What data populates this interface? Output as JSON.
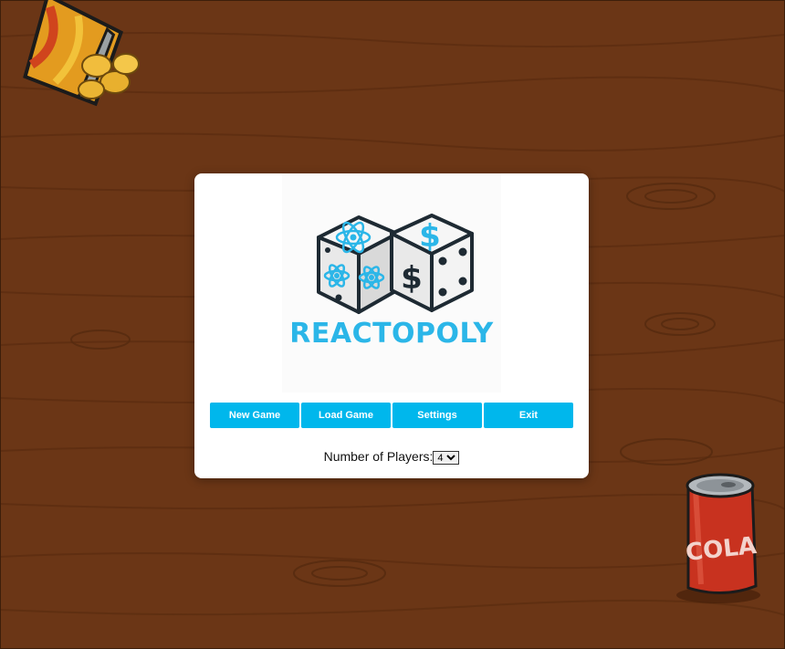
{
  "logo": {
    "title": "REACTOPOLY"
  },
  "menu": {
    "buttons": [
      {
        "label": "New Game"
      },
      {
        "label": "Load Game"
      },
      {
        "label": "Settings"
      },
      {
        "label": "Exit"
      }
    ]
  },
  "players": {
    "label": "Number of Players:",
    "selected": "4"
  },
  "decorations": {
    "can_label": "COLA"
  },
  "colors": {
    "accent": "#00b7ec",
    "logo_blue": "#2bb6e8",
    "table_wood": "#6b3616",
    "can_red": "#c8321f"
  },
  "icons": [
    "dice-logo-icon",
    "chips-bag-icon",
    "cola-can-icon"
  ]
}
